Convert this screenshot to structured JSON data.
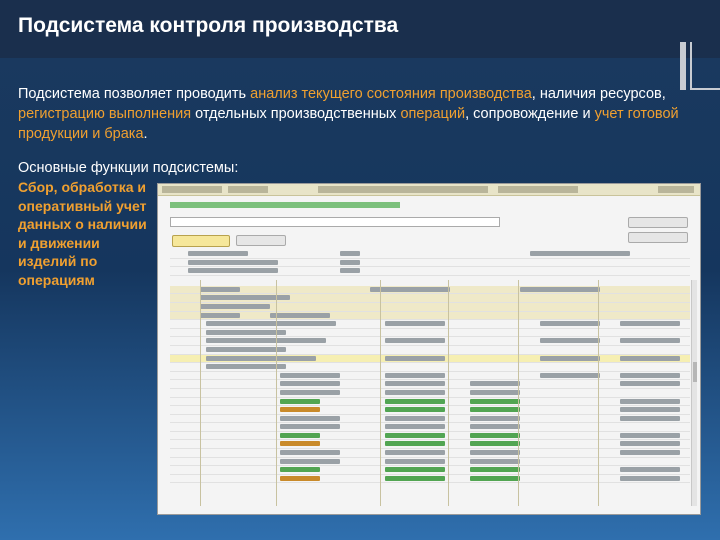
{
  "slide": {
    "title": "Подсистема контроля производства",
    "paragraph": {
      "p1": "Подсистема позволяет проводить ",
      "h1": "анализ текущего состояния производства",
      "p2": ", наличия ресурсов, ",
      "h2": "регистрацию выполнения",
      "p3": " отдельных производственных ",
      "h3": "операций",
      "p4": ", сопровождение и ",
      "h4": "учет готовой продукции и брака",
      "p5": "."
    },
    "subheading": "Основные функции подсистемы:",
    "functions_text": "Сбор, обработка и оперативный учет данных о наличии и движении изделий по операциям"
  },
  "colors": {
    "accent": "#f0a030",
    "title_bg": "#1a2f4d"
  }
}
